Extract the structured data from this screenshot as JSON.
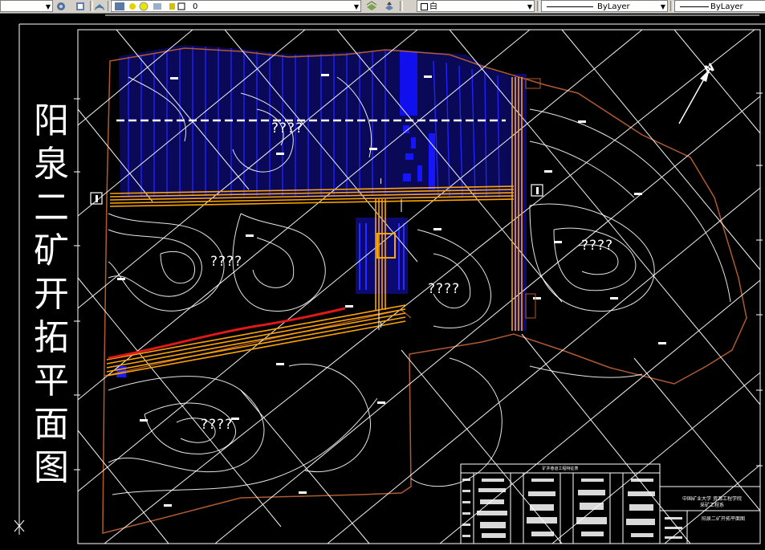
{
  "toolbar": {
    "layer_value": "0",
    "color_value": "白",
    "linetype_value": "ByLayer",
    "lineweight_value": "ByLayer"
  },
  "drawing": {
    "title_chars": [
      "阳",
      "泉",
      "二",
      "矿",
      "开",
      "拓",
      "平",
      "面",
      "图"
    ],
    "north_label": "N",
    "unknown_labels": [
      "????",
      "????",
      "????",
      "????",
      "????"
    ],
    "section_marks": [
      "I",
      "I"
    ],
    "table_header": "矿井巷道工程特征表",
    "title_block_school": "中国矿业大学 资源工程学院",
    "title_block_dept": "采矿工程系",
    "title_block_name": "阳泉二矿开拓平面图"
  },
  "colors": {
    "background": "#000000",
    "contour": "#ffffff",
    "roadway": "#ffa500",
    "goaf": "#0000cc",
    "boundary": "#b05a30",
    "grid": "#ffffff"
  }
}
